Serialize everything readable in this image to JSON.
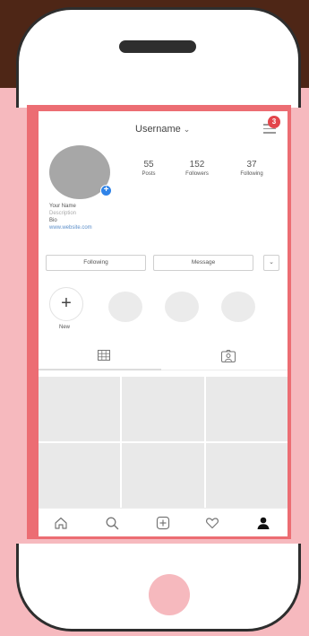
{
  "header": {
    "username": "Username",
    "chevron": "⌄",
    "notification_count": "3"
  },
  "profile": {
    "posts_count": "55",
    "posts_label": "Posts",
    "followers_count": "152",
    "followers_label": "Followers",
    "following_count": "37",
    "following_label": "Following",
    "name": "Your Name",
    "description": "Description",
    "bio": "Bio",
    "website": "www.website.com"
  },
  "actions": {
    "following_button": "Following",
    "message_button": "Message",
    "more_button": "⌄"
  },
  "highlights": {
    "new_label": "New",
    "new_icon": "+"
  },
  "tabs": {
    "grid_icon": "grid-icon",
    "tagged_icon": "tagged-photos-icon"
  },
  "bottom_nav": [
    "home-icon",
    "search-icon",
    "add-post-icon",
    "heart-icon",
    "profile-icon"
  ],
  "colors": {
    "brown": "#4e2616",
    "pink": "#f6b9be",
    "screen_border": "#ec6d73",
    "badge_red": "#e3454b",
    "accent_blue": "#2f83e8"
  }
}
